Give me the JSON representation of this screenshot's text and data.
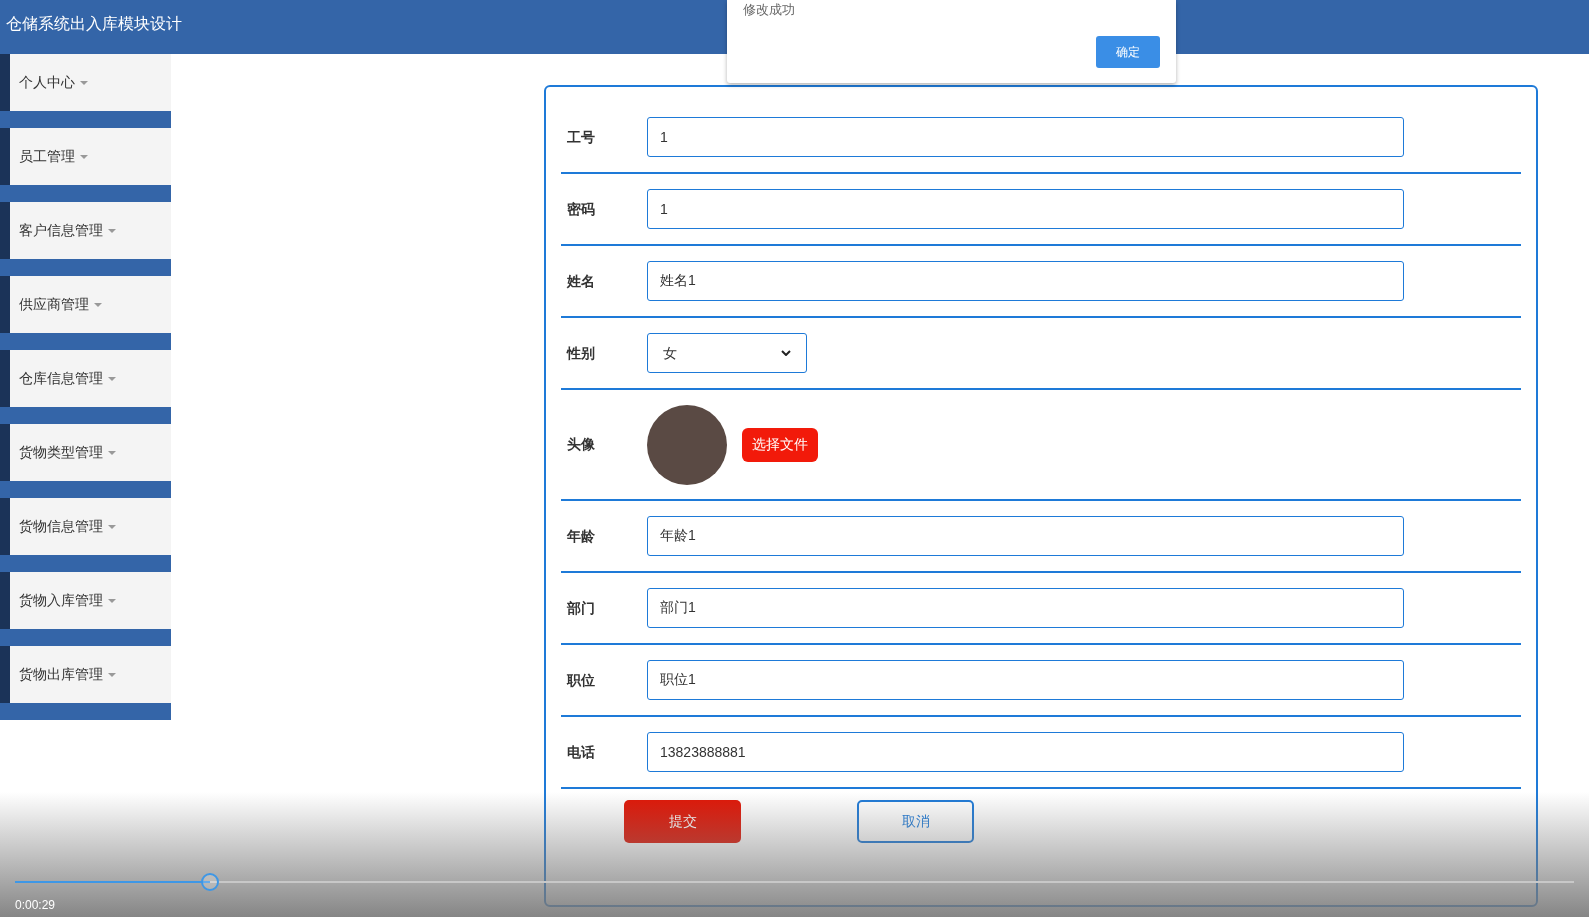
{
  "header": {
    "title": "仓储系统出入库模块设计"
  },
  "sidebar": {
    "items": [
      {
        "label": "个人中心"
      },
      {
        "label": "员工管理"
      },
      {
        "label": "客户信息管理"
      },
      {
        "label": "供应商管理"
      },
      {
        "label": "仓库信息管理"
      },
      {
        "label": "货物类型管理"
      },
      {
        "label": "货物信息管理"
      },
      {
        "label": "货物入库管理"
      },
      {
        "label": "货物出库管理"
      }
    ]
  },
  "form": {
    "fields": [
      {
        "kind": "text",
        "label": "工号",
        "value": "1"
      },
      {
        "kind": "text",
        "label": "密码",
        "value": "1"
      },
      {
        "kind": "text",
        "label": "姓名",
        "value": "姓名1"
      },
      {
        "kind": "select",
        "label": "性别",
        "value": "女"
      },
      {
        "kind": "avatar",
        "label": "头像",
        "button": "选择文件"
      },
      {
        "kind": "text",
        "label": "年龄",
        "value": "年龄1"
      },
      {
        "kind": "text",
        "label": "部门",
        "value": "部门1"
      },
      {
        "kind": "text",
        "label": "职位",
        "value": "职位1"
      },
      {
        "kind": "text",
        "label": "电话",
        "value": "13823888881"
      }
    ],
    "submit": "提交",
    "cancel": "取消"
  },
  "dialog": {
    "message": "修改成功",
    "ok": "确定"
  },
  "player": {
    "level": 0.125,
    "time": "0:00:29"
  }
}
